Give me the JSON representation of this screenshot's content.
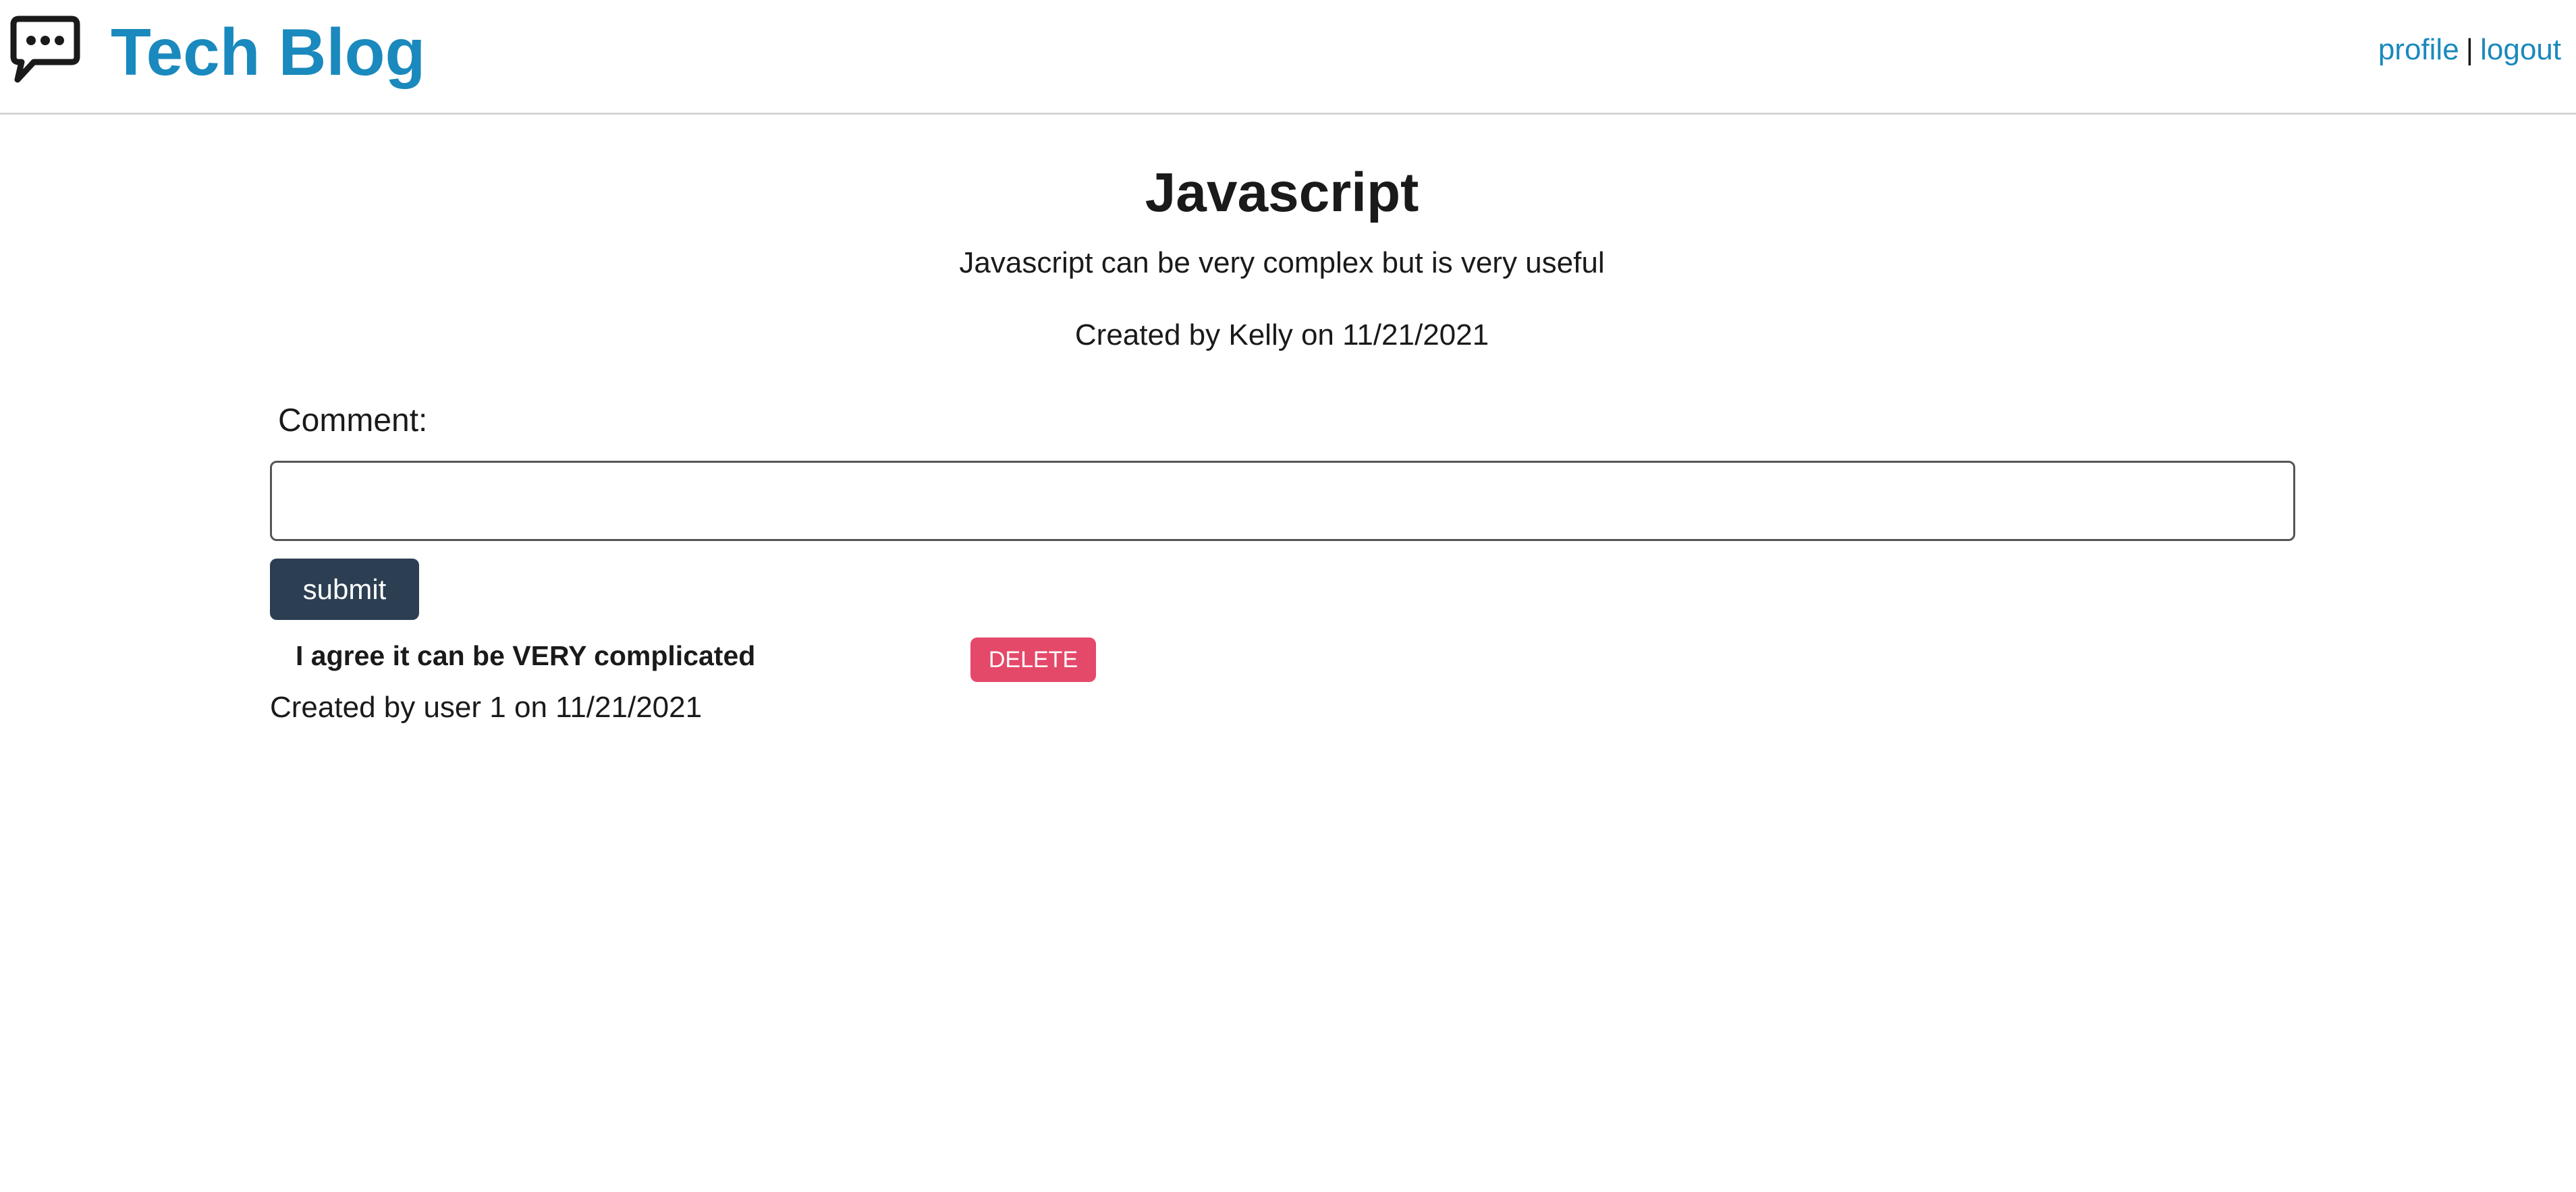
{
  "header": {
    "brand": {
      "icon": "chat-bubble-icon",
      "title": "Tech Blog",
      "color": "#1a89bd"
    },
    "nav": {
      "profile_label": "profile",
      "separator": "|",
      "logout_label": "logout"
    }
  },
  "post": {
    "title": "Javascript",
    "body": "Javascript can be very complex but is very useful",
    "meta": "Created by Kelly on 11/21/2021"
  },
  "comment_form": {
    "label": "Comment:",
    "input_value": "",
    "input_placeholder": "",
    "submit_label": "submit",
    "submit_color": "#2c3e52"
  },
  "comments": [
    {
      "text": "I agree it can be VERY complicated",
      "delete_label": "DELETE",
      "delete_color": "#e5496a",
      "meta": "Created by user 1 on 11/21/2021"
    }
  ]
}
